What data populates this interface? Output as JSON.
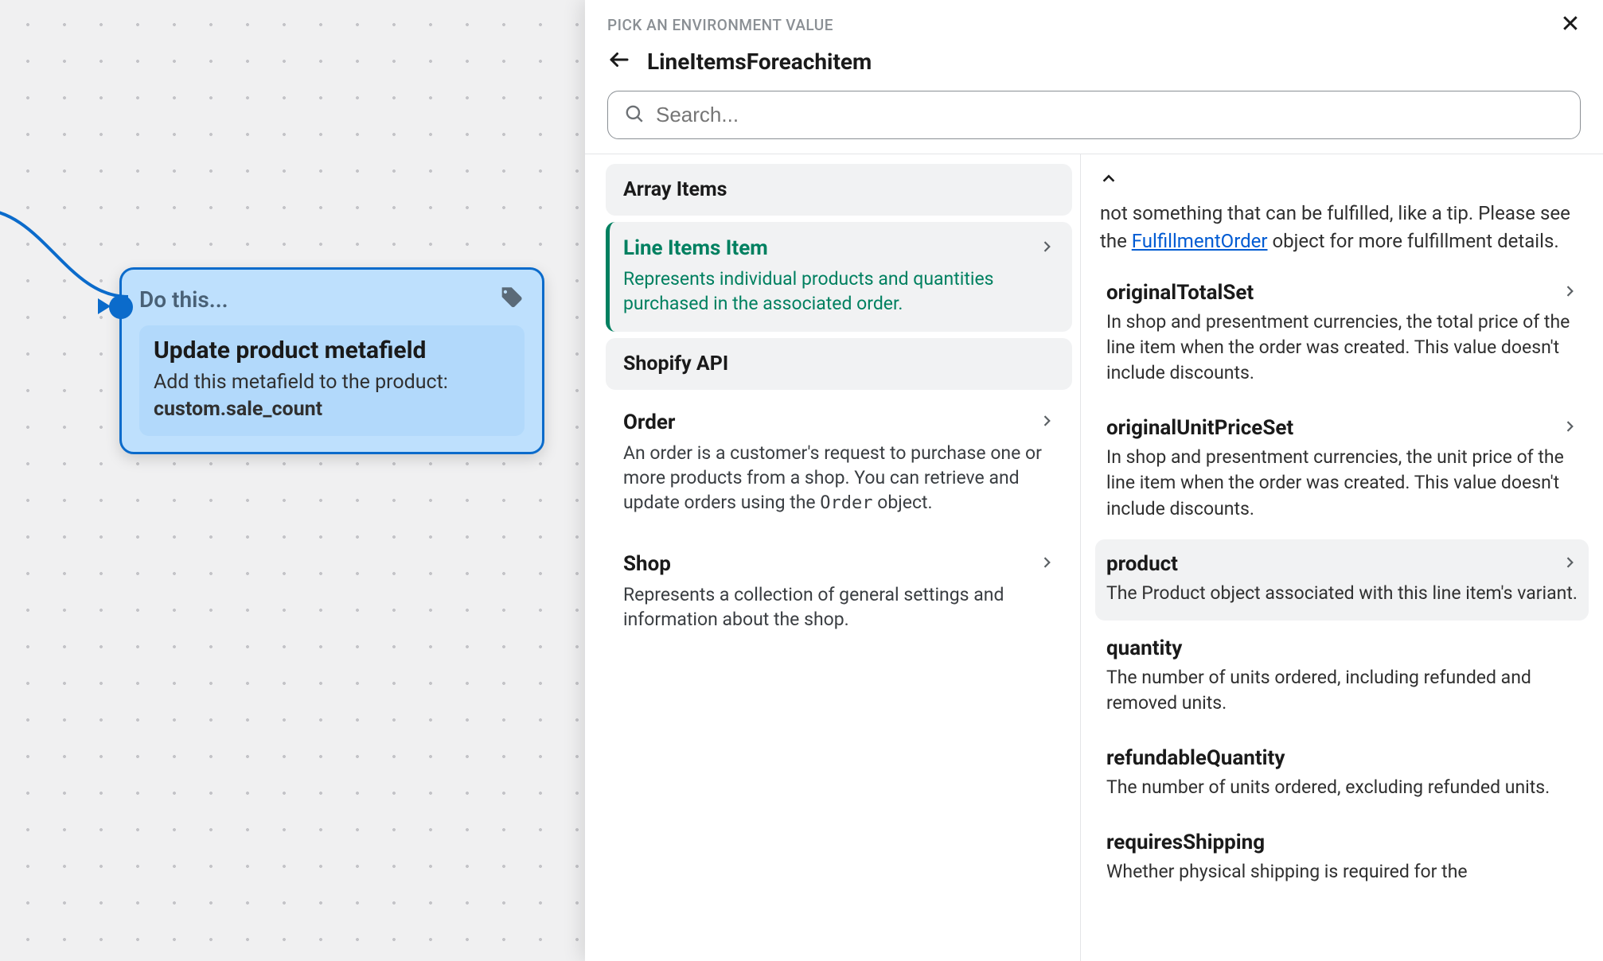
{
  "canvas": {
    "card": {
      "eyebrow": "Do this...",
      "title": "Update product metafield",
      "subtitle_prefix": "Add this metafield to the product:",
      "metafield_ns": "custom",
      "metafield_key": "sale_count"
    }
  },
  "panel": {
    "eyebrow": "PICK AN ENVIRONMENT VALUE",
    "title": "LineItemsForeachitem",
    "search_placeholder": "Search...",
    "left": {
      "sections": [
        {
          "header": "Array Items",
          "items": [
            {
              "title": "Line Items Item",
              "desc": "Represents individual products and quantities purchased in the associated order.",
              "selected": true,
              "chevron": true
            }
          ]
        },
        {
          "header": "Shopify API",
          "items": [
            {
              "title": "Order",
              "desc_pre": "An order is a customer's request to purchase one or more products from a shop. You can retrieve and update orders using the ",
              "desc_code": "Order",
              "desc_post": " object.",
              "chevron": true
            },
            {
              "title": "Shop",
              "desc": "Represents a collection of general settings and information about the shop.",
              "chevron": true
            }
          ]
        }
      ]
    },
    "right": {
      "snippet_pre": "not something that can be fulfilled, like a tip. Please see the ",
      "snippet_link": "FulfillmentOrder",
      "snippet_post": " object for more fulfillment details.",
      "fields": [
        {
          "name": "originalTotalSet",
          "desc": "In shop and presentment currencies, the total price of the line item when the order was created. This value doesn't include discounts.",
          "chevron": true
        },
        {
          "name": "originalUnitPriceSet",
          "desc": "In shop and presentment currencies, the unit price of the line item when the order was created. This value doesn't include discounts.",
          "chevron": true
        },
        {
          "name": "product",
          "desc": "The Product object associated with this line item's variant.",
          "chevron": true,
          "hover": true
        },
        {
          "name": "quantity",
          "desc": "The number of units ordered, including refunded and removed units."
        },
        {
          "name": "refundableQuantity",
          "desc": "The number of units ordered, excluding refunded units."
        },
        {
          "name": "requiresShipping",
          "desc": "Whether physical shipping is required for the"
        }
      ]
    }
  }
}
